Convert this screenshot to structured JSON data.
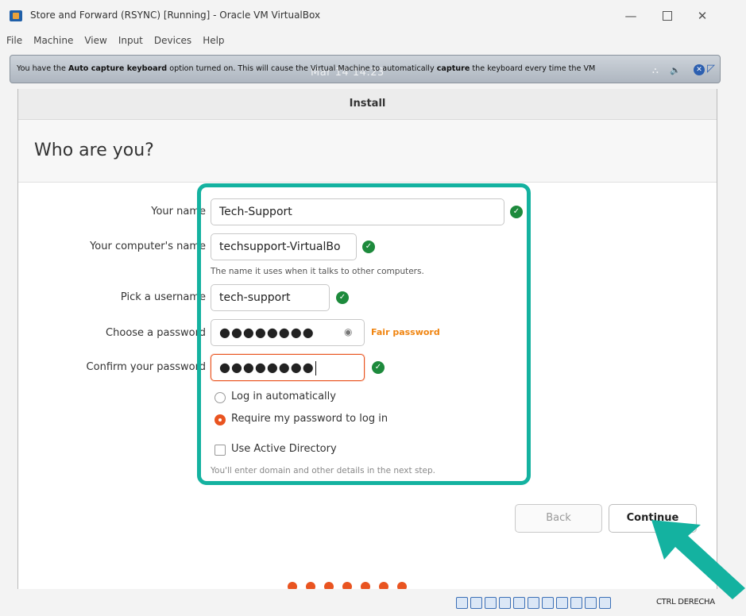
{
  "window": {
    "title": "Store and Forward (RSYNC) [Running] - Oracle VM VirtualBox",
    "minimize_glyph": "—",
    "close_glyph": "✕"
  },
  "menu": [
    "File",
    "Machine",
    "View",
    "Input",
    "Devices",
    "Help"
  ],
  "notice": {
    "text_before": "You have the ",
    "bold_1": "Auto capture keyboard",
    "text_middle": " option turned on. This will cause the Virtual Machine to automatically ",
    "bold_2": "capture",
    "text_after": " the keyboard every time the VM",
    "clock": "Mar 14  14:23"
  },
  "installer": {
    "header": "Install",
    "page_title": "Who are you?",
    "fields": {
      "name": {
        "label": "Your name",
        "value": "Tech-Support"
      },
      "computer": {
        "label": "Your computer's name",
        "value": "techsupport-VirtualBo",
        "hint": "The name it uses when it talks to other computers."
      },
      "username": {
        "label": "Pick a username",
        "value": "tech-support"
      },
      "password": {
        "label": "Choose a password",
        "value": "●●●●●●●●",
        "strength": "Fair password"
      },
      "confirm": {
        "label": "Confirm your password",
        "value": "●●●●●●●●"
      }
    },
    "login": {
      "auto_label": "Log in automatically",
      "require_label": "Require my password to log in",
      "selected": "require"
    },
    "active_directory": {
      "label": "Use Active Directory",
      "checked": false,
      "hint": "You'll enter domain and other details in the next step."
    },
    "buttons": {
      "back": "Back",
      "continue": "Continue"
    },
    "progress_steps": 7
  },
  "statusbar": {
    "host_key": "CTRL DERECHA"
  },
  "colors": {
    "accent": "#e95420",
    "highlight": "#14b2a0",
    "success": "#1d8a3c",
    "strength": "#f0840f"
  }
}
